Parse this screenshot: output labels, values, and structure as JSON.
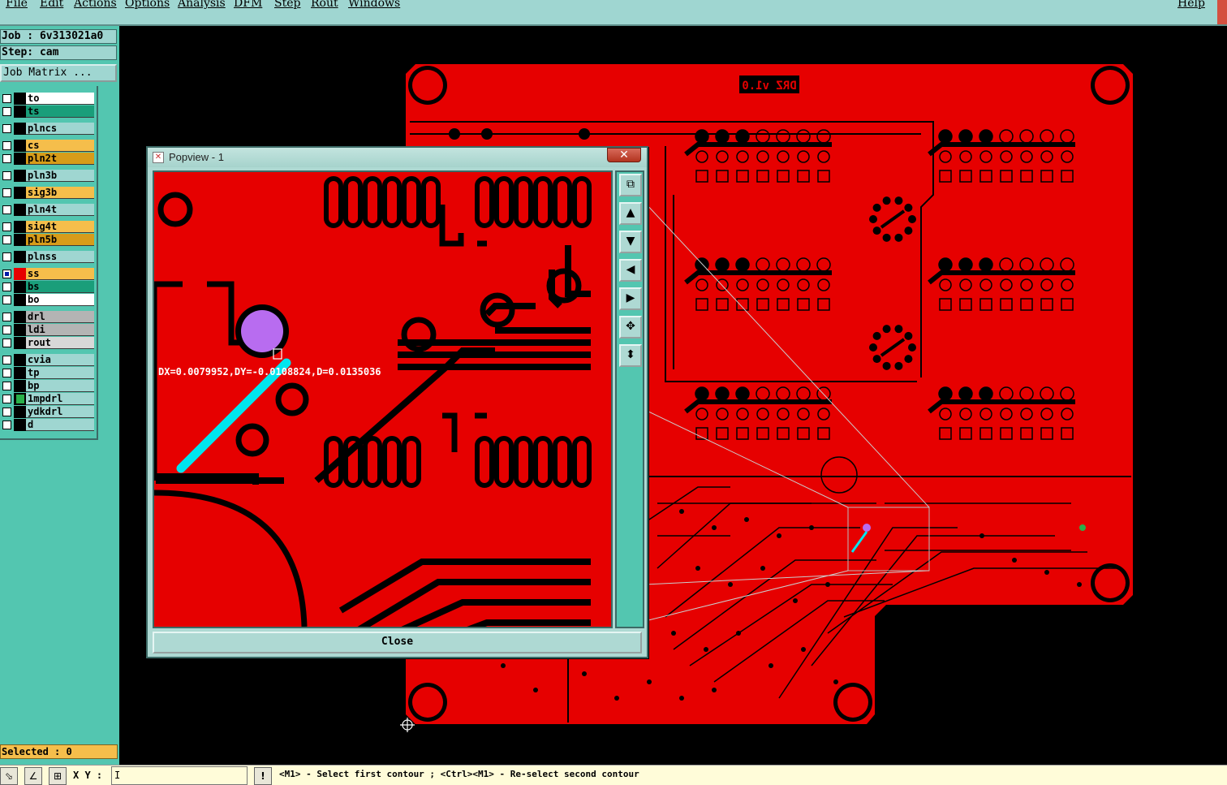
{
  "menubar": {
    "items": [
      "File",
      "Edit",
      "Actions",
      "Options",
      "Analysis",
      "DFM",
      "Step",
      "Rout",
      "Windows"
    ],
    "help": "Help"
  },
  "job": {
    "job_label": "Job : 6v313021a0",
    "step_label": "Step: cam",
    "matrix_button": "Job Matrix ..."
  },
  "layers": [
    {
      "name": "to",
      "color": "#ffffff"
    },
    {
      "name": "ts",
      "color": "#1a9e7a"
    },
    {
      "name": "plncs",
      "color": "#9fd6d1"
    },
    {
      "name": "cs",
      "color": "#f5be4b"
    },
    {
      "name": "pln2t",
      "color": "#d79c1a"
    },
    {
      "name": "pln3b",
      "color": "#9fd6d1"
    },
    {
      "name": "sig3b",
      "color": "#f5be4b"
    },
    {
      "name": "pln4t",
      "color": "#9fd6d1"
    },
    {
      "name": "sig4t",
      "color": "#f5be4b"
    },
    {
      "name": "pln5b",
      "color": "#d79c1a"
    },
    {
      "name": "plnss",
      "color": "#9fd6d1"
    },
    {
      "name": "ss",
      "color": "#f5be4b"
    },
    {
      "name": "bs",
      "color": "#1a9e7a"
    },
    {
      "name": "bo",
      "color": "#ffffff"
    },
    {
      "name": "drl",
      "color": "#b4b4b4"
    },
    {
      "name": "ldi",
      "color": "#b4b4b4"
    },
    {
      "name": "rout",
      "color": "#d8d8d8"
    },
    {
      "name": "cvia",
      "color": "#9fd6d1"
    },
    {
      "name": "tp",
      "color": "#9fd6d1"
    },
    {
      "name": "bp",
      "color": "#9fd6d1"
    },
    {
      "name": "1mpdrl",
      "color": "#9fd6d1"
    },
    {
      "name": "ydkdrl",
      "color": "#9fd6d1"
    },
    {
      "name": "d",
      "color": "#9fd6d1"
    }
  ],
  "selected_label": "Selected : 0",
  "statusbar": {
    "xy_label": "X Y :",
    "xy_value": "I",
    "warning_icon": "!",
    "prompt": "<M1> - Select first contour ; <Ctrl><M1> - Re-select second contour"
  },
  "board": {
    "silk_text": "DRZ v1.0"
  },
  "popview": {
    "title": "Popview - 1",
    "close_x": "✕",
    "measure": "DX=0.0079952,DY=-0.0108824,D=0.0135036",
    "close_button": "Close",
    "tools": [
      "zoom-fit-icon",
      "pan-up-icon",
      "pan-down-icon",
      "pan-left-icon",
      "pan-right-icon",
      "zoom-extents-icon",
      "zoom-reset-icon"
    ]
  },
  "colors": {
    "copper": "#e60000",
    "menubar": "#9fd6d1",
    "panel": "#53c6b0",
    "measure_line": "#00e5ee",
    "pad_highlight": "#b86cf0"
  }
}
